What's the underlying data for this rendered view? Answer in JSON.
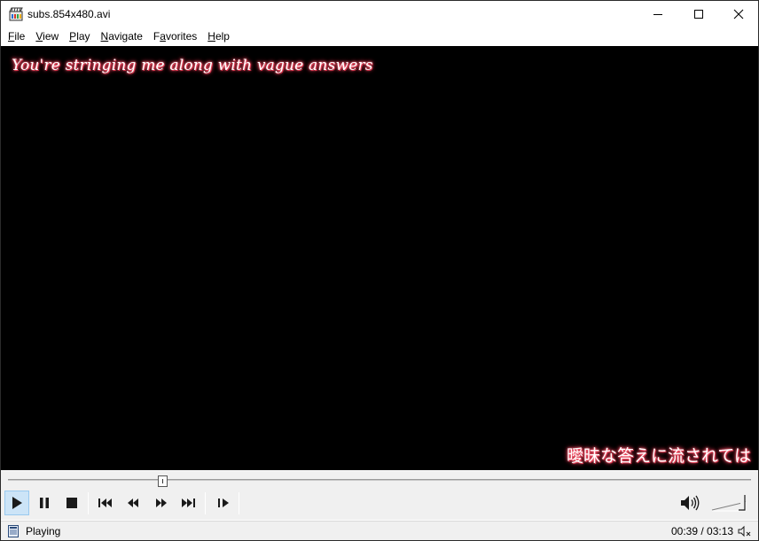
{
  "window": {
    "title": "subs.854x480.avi"
  },
  "menu": [
    {
      "label": "File",
      "key": "F",
      "rest": "ile",
      "pre": ""
    },
    {
      "label": "View",
      "key": "V",
      "rest": "iew",
      "pre": ""
    },
    {
      "label": "Play",
      "key": "P",
      "rest": "lay",
      "pre": ""
    },
    {
      "label": "Navigate",
      "key": "N",
      "rest": "avigate",
      "pre": ""
    },
    {
      "label": "Favorites",
      "key": "a",
      "rest": "vorites",
      "pre": "F"
    },
    {
      "label": "Help",
      "key": "H",
      "rest": "elp",
      "pre": ""
    }
  ],
  "video": {
    "subtitle_top": "You're stringing me along with vague answers",
    "subtitle_bottom": "曖昧な答えに流されては"
  },
  "playback": {
    "position": 0.208,
    "volume": 1.0
  },
  "status": {
    "state": "Playing",
    "time": "00:39 / 03:13"
  },
  "icons": {
    "app": "media-player-clapper-icon",
    "minimize": "minimize-icon",
    "maximize": "maximize-icon",
    "close": "close-icon",
    "play": "play-icon",
    "pause": "pause-icon",
    "stop": "stop-icon",
    "prev": "skip-previous-icon",
    "rewind": "rewind-icon",
    "forward": "fast-forward-icon",
    "next": "skip-next-icon",
    "frame_step": "frame-step-icon",
    "volume": "speaker-icon",
    "mute": "mute-icon"
  },
  "colors": {
    "subtitle_glow": "#ff4d66",
    "active_button": "#cce4f7"
  }
}
